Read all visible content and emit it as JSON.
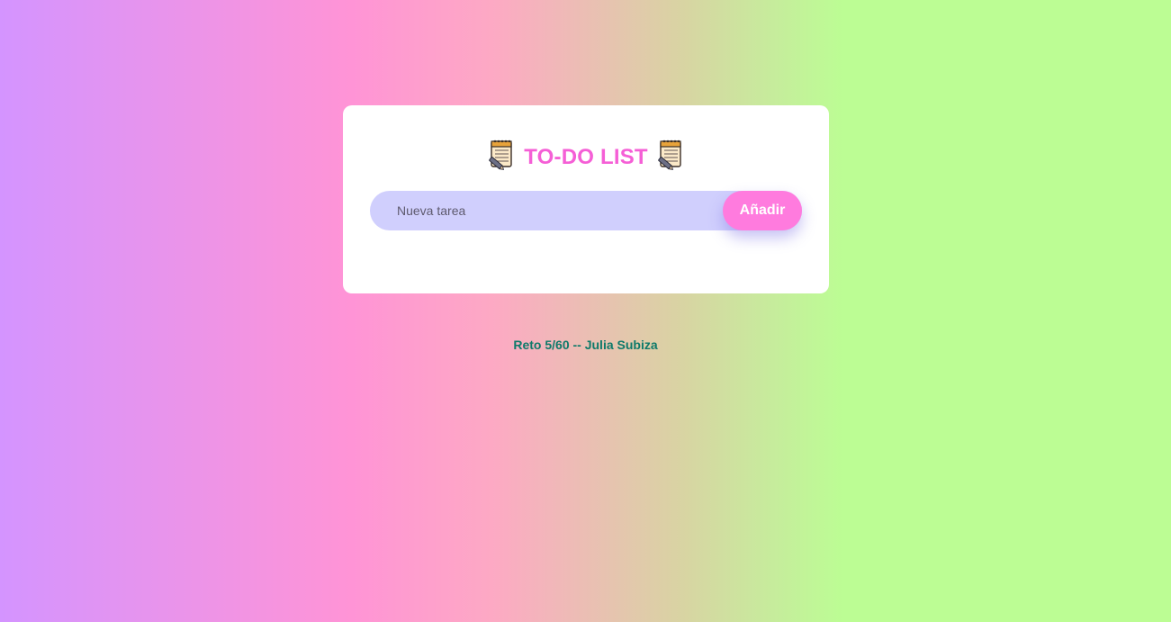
{
  "app": {
    "title": "TO-DO LIST",
    "title_icon": "notepad-icon"
  },
  "form": {
    "input_placeholder": "Nueva tarea",
    "input_value": "",
    "add_button_label": "Añadir"
  },
  "footer": {
    "credit": "Reto 5/60 -- Julia Subiza"
  },
  "colors": {
    "title": "#f55fd6",
    "button": "#ff7bde",
    "input_background": "#d0cffd",
    "footer_text": "#0e7a6a",
    "gradient": [
      "#d494ff",
      "#ff94d6",
      "#fda9c4",
      "#bcfd94"
    ]
  }
}
